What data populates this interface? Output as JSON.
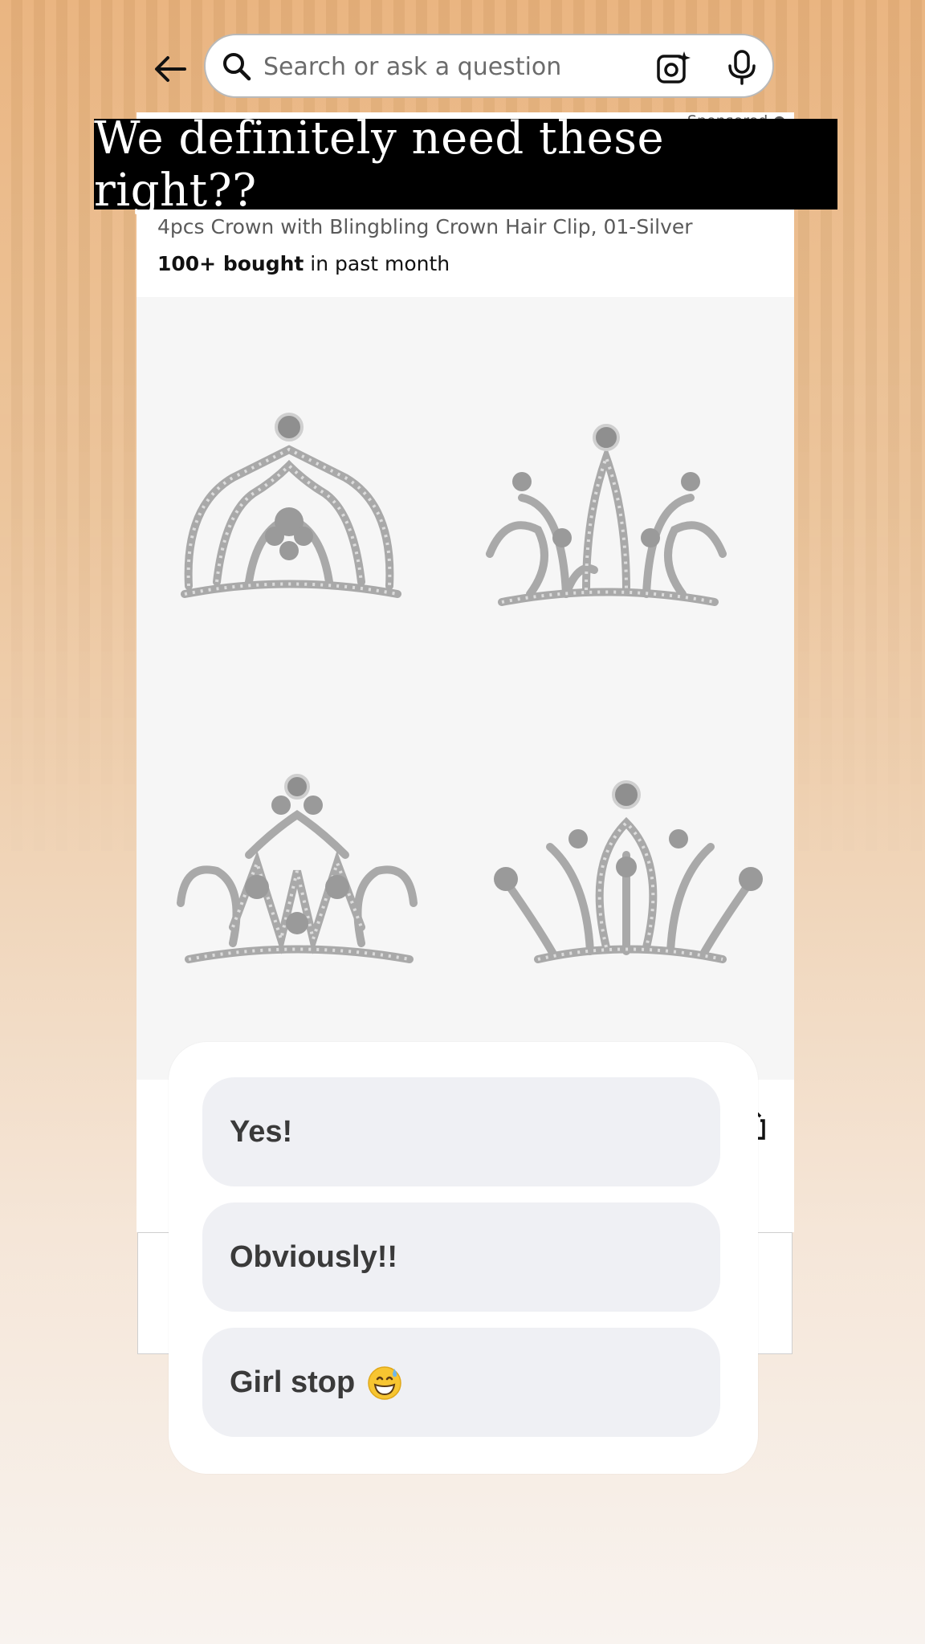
{
  "search": {
    "placeholder": "Search or ask a question"
  },
  "product": {
    "sponsored_label": "Sponsored",
    "title": "4pcs Crown with Blingbling Crown Hair Clip, 01-Silver",
    "bought_bold": "100+ bought",
    "bought_rest": " in past month"
  },
  "caption": "We definitely need these right??",
  "poll": {
    "options": [
      {
        "label": "Yes!"
      },
      {
        "label": "Obviously!!"
      },
      {
        "label": "Girl stop",
        "emoji": "grinning-sweat-emoji"
      }
    ]
  },
  "icons": {
    "back": "back-arrow-icon",
    "search": "search-icon",
    "camera": "camera-sparkle-icon",
    "mic": "microphone-icon",
    "sponsored_info": "info-icon"
  },
  "colors": {
    "caption_bg": "#000000",
    "poll_option_bg": "#eff0f4",
    "bg_top": "#e9b27b",
    "bg_bottom": "#f8f3ef"
  }
}
